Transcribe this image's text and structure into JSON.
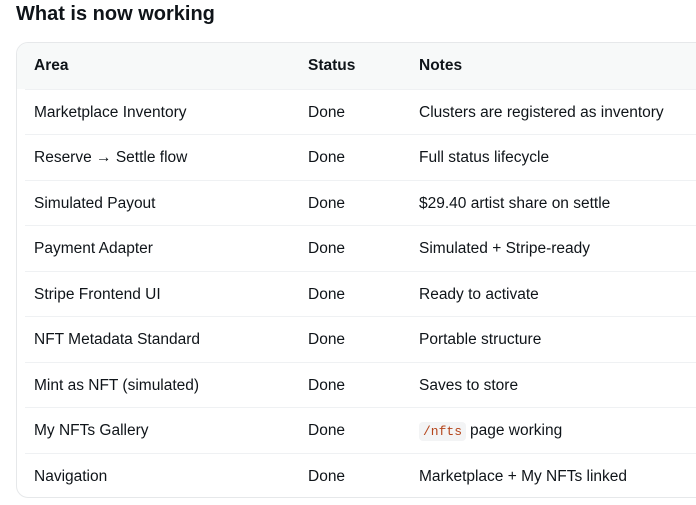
{
  "heading": "What is now working",
  "table": {
    "headers": [
      "Area",
      "Status",
      "Notes"
    ],
    "rows": [
      {
        "area": "Marketplace Inventory",
        "status": "Done",
        "notes": "Clusters are registered as inventory"
      },
      {
        "area": "Reserve → Settle flow",
        "status": "Done",
        "notes": "Full status lifecycle"
      },
      {
        "area": "Simulated Payout",
        "status": "Done",
        "notes": "$29.40 artist share on settle"
      },
      {
        "area": "Payment Adapter",
        "status": "Done",
        "notes": "Simulated + Stripe-ready"
      },
      {
        "area": "Stripe Frontend UI",
        "status": "Done",
        "notes": "Ready to activate"
      },
      {
        "area": "NFT Metadata Standard",
        "status": "Done",
        "notes": "Portable structure"
      },
      {
        "area": "Mint as NFT (simulated)",
        "status": "Done",
        "notes": "Saves to store"
      },
      {
        "area": "My NFTs Gallery",
        "status": "Done",
        "notes_code": "/nfts",
        "notes": "page working"
      },
      {
        "area": "Navigation",
        "status": "Done",
        "notes": "Marketplace + My NFTs linked"
      }
    ]
  }
}
